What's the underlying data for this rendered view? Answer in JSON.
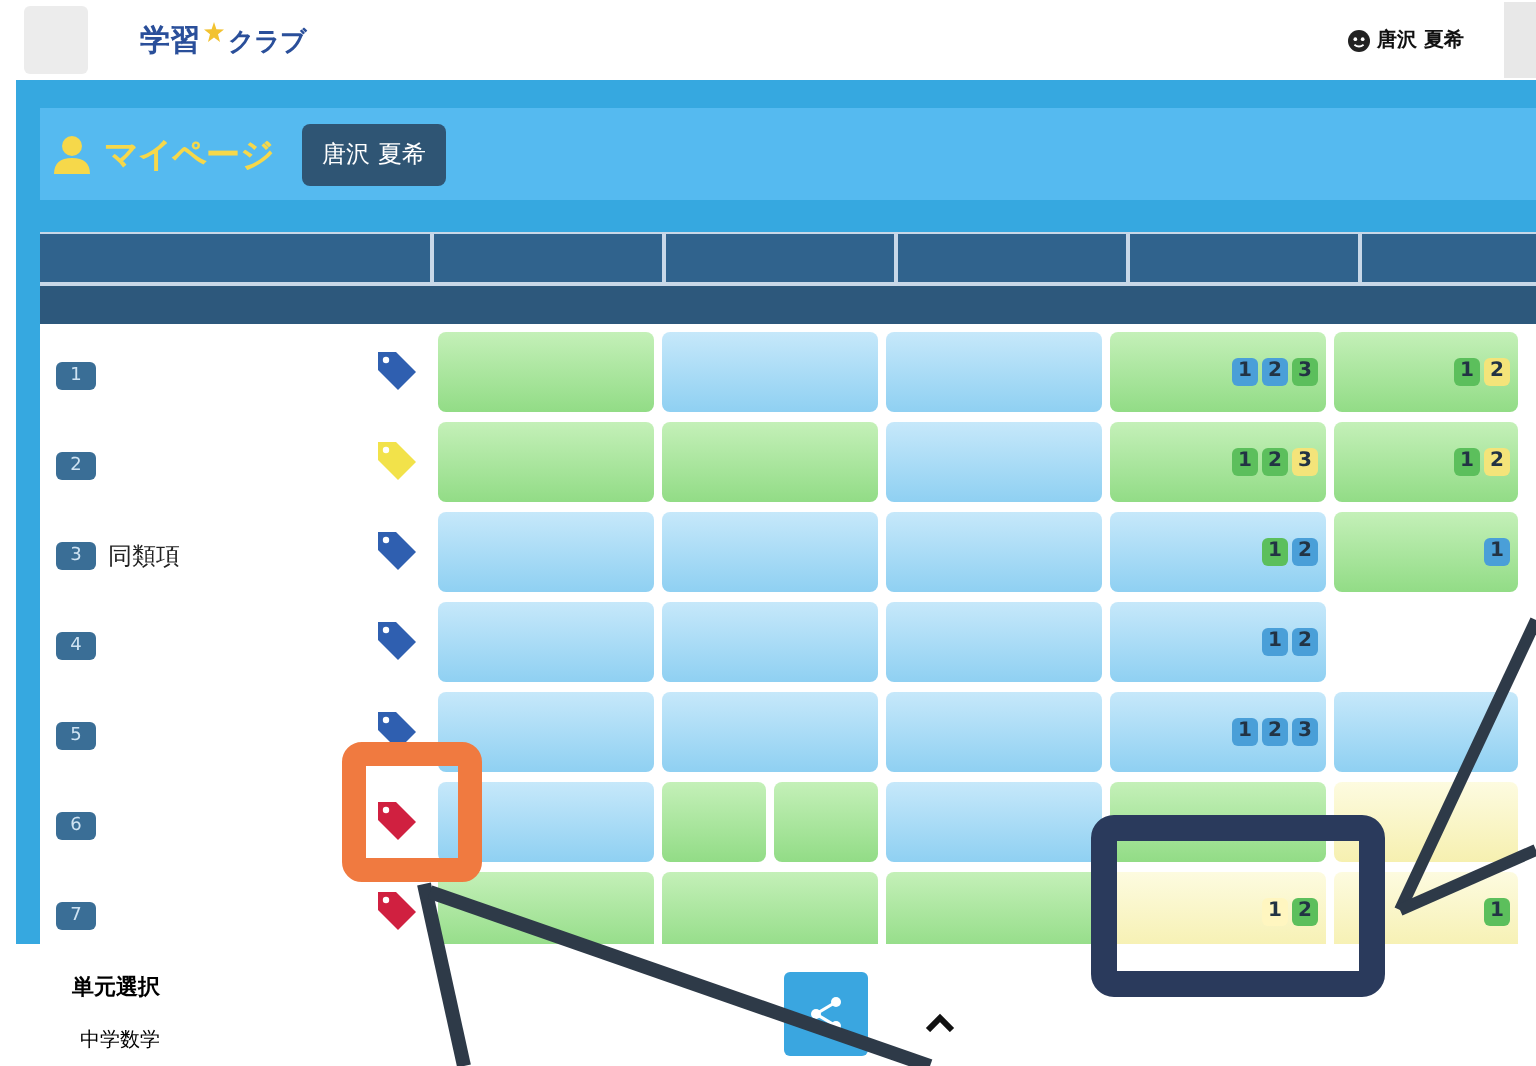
{
  "header": {
    "logo_parts": [
      "学習",
      "クラブ"
    ],
    "user_name": "唐沢 夏希"
  },
  "mypage": {
    "title": "マイページ",
    "student_name": "唐沢 夏希"
  },
  "rows": [
    {
      "number": "1",
      "color": "#2f5fb0",
      "cells": [
        {
          "kind": "green"
        },
        {
          "kind": "blue"
        },
        {
          "kind": "blue"
        },
        {
          "kind": "green",
          "badges": [
            {
              "text": "1",
              "color": "#4a9fd8"
            },
            {
              "text": "2",
              "color": "#4a9fd8"
            },
            {
              "text": "3",
              "color": "#5cbf5c"
            }
          ]
        },
        {
          "kind": "green",
          "badges": [
            {
              "text": "1",
              "color": "#5cbf5c"
            },
            {
              "text": "2",
              "color": "#f4e47a"
            }
          ]
        }
      ]
    },
    {
      "number": "2",
      "color": "#f2e24a",
      "cells": [
        {
          "kind": "green"
        },
        {
          "kind": "green"
        },
        {
          "kind": "blue"
        },
        {
          "kind": "green",
          "badges": [
            {
              "text": "1",
              "color": "#5cbf5c"
            },
            {
              "text": "2",
              "color": "#5cbf5c"
            },
            {
              "text": "3",
              "color": "#f4e47a"
            }
          ]
        },
        {
          "kind": "green",
          "badges": [
            {
              "text": "1",
              "color": "#5cbf5c"
            },
            {
              "text": "2",
              "color": "#f4e47a"
            }
          ]
        }
      ]
    },
    {
      "number": "3",
      "label": "同類項",
      "color": "#2f5fb0",
      "cells": [
        {
          "kind": "blue"
        },
        {
          "kind": "blue"
        },
        {
          "kind": "blue"
        },
        {
          "kind": "blue",
          "badges": [
            {
              "text": "1",
              "color": "#5cbf5c"
            },
            {
              "text": "2",
              "color": "#4a9fd8"
            }
          ]
        },
        {
          "kind": "green",
          "badges": [
            {
              "text": "1",
              "color": "#4a9fd8"
            }
          ]
        }
      ]
    },
    {
      "number": "4",
      "color": "#2f5fb0",
      "cells": [
        {
          "kind": "blue"
        },
        {
          "kind": "blue"
        },
        {
          "kind": "blue"
        },
        {
          "kind": "blue",
          "badges": [
            {
              "text": "1",
              "color": "#4a9fd8"
            },
            {
              "text": "2",
              "color": "#4a9fd8"
            }
          ]
        },
        {
          "kind": "empty"
        }
      ]
    },
    {
      "number": "5",
      "color": "#2f5fb0",
      "cells": [
        {
          "kind": "blue"
        },
        {
          "kind": "blue"
        },
        {
          "kind": "blue"
        },
        {
          "kind": "blue",
          "badges": [
            {
              "text": "1",
              "color": "#4a9fd8"
            },
            {
              "text": "2",
              "color": "#4a9fd8"
            },
            {
              "text": "3",
              "color": "#4a9fd8"
            }
          ]
        },
        {
          "kind": "blue"
        }
      ]
    },
    {
      "number": "6",
      "color": "#d02040",
      "cells": [
        {
          "kind": "blue"
        },
        {
          "kind": "split"
        },
        {
          "kind": "blue"
        },
        {
          "kind": "green"
        },
        {
          "kind": "yellow"
        }
      ]
    },
    {
      "number": "7",
      "color": "#d02040",
      "cells": [
        {
          "kind": "green"
        },
        {
          "kind": "green"
        },
        {
          "kind": "green"
        },
        {
          "kind": "yellow",
          "badges": [
            {
              "text": "1",
              "color": "#fff6c0"
            },
            {
              "text": "2",
              "color": "#5cbf5c"
            }
          ]
        },
        {
          "kind": "yellow",
          "badges": [
            {
              "text": "1",
              "color": "#5cbf5c"
            }
          ]
        }
      ]
    }
  ],
  "footer": {
    "section_title": "単元選択",
    "subject": "中学数学"
  }
}
